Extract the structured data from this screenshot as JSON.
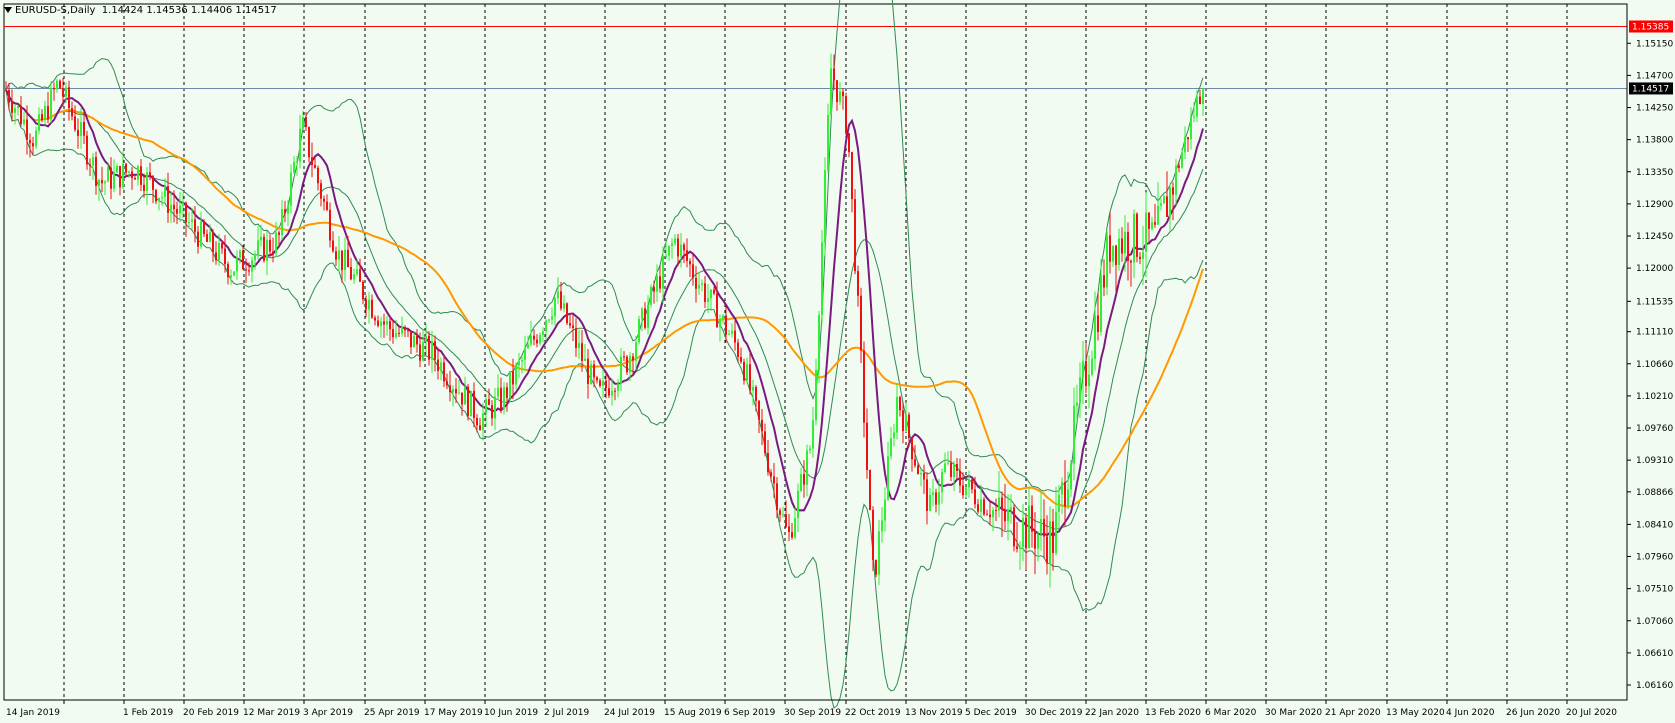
{
  "header": {
    "symbol": "EURUSD-S",
    "timeframe": "Daily",
    "open": "1.14424",
    "high": "1.14536",
    "low": "1.14406",
    "close": "1.14517"
  },
  "colors": {
    "background": "#f2fbf2",
    "bull": "#33ee33",
    "bear": "#ee1111",
    "ma_fast": "#7a1a80",
    "ma_slow": "#ff9900",
    "bands": "#2f8a52",
    "current_line": "#7088a8",
    "level_line": "#ff0000",
    "separator": "#000000"
  },
  "chart_data": {
    "type": "candlestick",
    "instrument": "EURUSD-S",
    "timeframe": "Daily",
    "ylim": [
      1.0595,
      1.157
    ],
    "y_ticks": [
      "1.15150",
      "1.14700",
      "1.14250",
      "1.13800",
      "1.13350",
      "1.12900",
      "1.12450",
      "1.12000",
      "1.11535",
      "1.11110",
      "1.10660",
      "1.10210",
      "1.09760",
      "1.09310",
      "1.08866",
      "1.08410",
      "1.07960",
      "1.07510",
      "1.07060",
      "1.06610",
      "1.06160"
    ],
    "x_labels": [
      "14 Jan 2019",
      "1 Feb 2019",
      "20 Feb 2019",
      "12 Mar 2019",
      "3 Apr 2019",
      "25 Apr 2019",
      "17 May 2019",
      "10 Jun 2019",
      "2 Jul 2019",
      "24 Jul 2019",
      "15 Aug 2019",
      "6 Sep 2019",
      "30 Sep 2019",
      "22 Oct 2019",
      "13 Nov 2019",
      "5 Dec 2019",
      "30 Dec 2019",
      "22 Jan 2020",
      "13 Feb 2020",
      "6 Mar 2020",
      "30 Mar 2020",
      "21 Apr 2020",
      "13 May 2020",
      "4 Jun 2020",
      "26 Jun 2020",
      "20 Jul 2020"
    ],
    "current_price": "1.14517",
    "level_line": "1.15385",
    "bars": 400,
    "anchors": [
      [
        0,
        1.145
      ],
      [
        12,
        1.138
      ],
      [
        22,
        1.146
      ],
      [
        40,
        1.132
      ],
      [
        55,
        1.134
      ],
      [
        75,
        1.127
      ],
      [
        95,
        1.12
      ],
      [
        115,
        1.124
      ],
      [
        125,
        1.14
      ],
      [
        140,
        1.122
      ],
      [
        160,
        1.112
      ],
      [
        180,
        1.108
      ],
      [
        200,
        1.099
      ],
      [
        210,
        1.102
      ],
      [
        232,
        1.116
      ],
      [
        250,
        1.102
      ],
      [
        262,
        1.107
      ],
      [
        282,
        1.124
      ],
      [
        310,
        1.108
      ],
      [
        330,
        1.082
      ],
      [
        340,
        1.096
      ],
      [
        348,
        1.148
      ],
      [
        355,
        1.14
      ],
      [
        366,
        1.076
      ],
      [
        376,
        1.102
      ],
      [
        390,
        1.086
      ],
      [
        396,
        1.092
      ],
      [
        420,
        1.085
      ],
      [
        442,
        1.082
      ],
      [
        466,
        1.124
      ],
      [
        485,
        1.124
      ],
      [
        505,
        1.146
      ]
    ]
  }
}
